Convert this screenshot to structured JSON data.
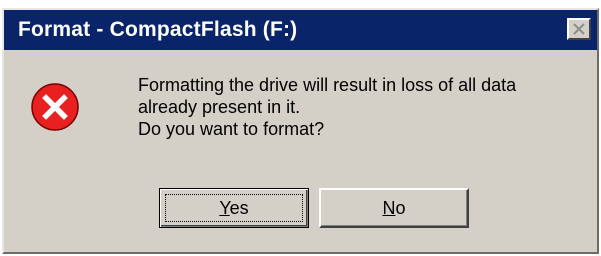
{
  "dialog": {
    "title": "Format - CompactFlash (F:)",
    "icon": "error-icon",
    "message_lines": [
      "Formatting the drive will result in loss of all data",
      "already present in it.",
      "Do you want to format?"
    ],
    "buttons": {
      "yes": {
        "mnemonic": "Y",
        "rest": "es"
      },
      "no": {
        "mnemonic": "N",
        "rest": "o"
      }
    }
  },
  "colors": {
    "titlebar": "#0a246a",
    "face": "#d4d0c8",
    "error_red": "#e82020"
  }
}
